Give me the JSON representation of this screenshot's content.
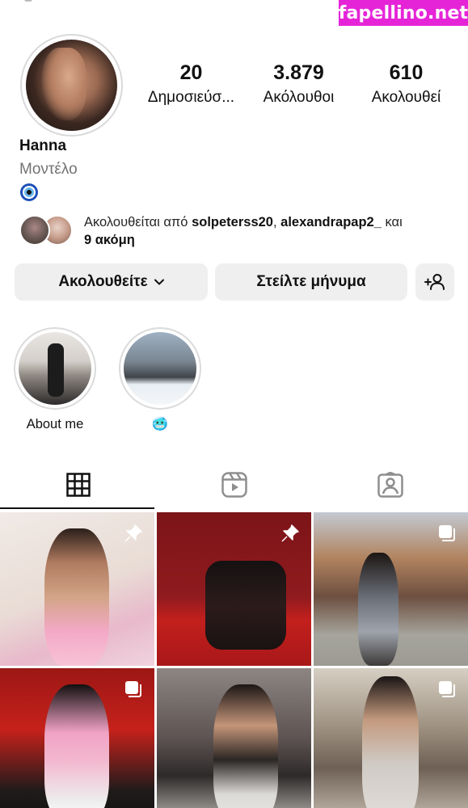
{
  "watermark": "fapellino.net",
  "profile": {
    "name": "Hanna",
    "category": "Μοντέλο",
    "bio_emoji": "evil-eye-emoji",
    "stats": [
      {
        "value": "20",
        "label": "Δημοσιεύσ..."
      },
      {
        "value": "3.879",
        "label": "Ακόλουθοι"
      },
      {
        "value": "610",
        "label": "Ακολουθεί"
      }
    ],
    "followed_by": {
      "prefix": "Ακολουθείται από ",
      "user1": "solpeterss20",
      "separator": ", ",
      "user2": "alexandrapap2_",
      "conjunction": " και",
      "more": "9 ακόμη"
    }
  },
  "actions": {
    "following_label": "Ακολουθείτε",
    "message_label": "Στείλτε μήνυμα",
    "add_user_icon": "add-person-icon"
  },
  "highlights": [
    {
      "label": "About me"
    },
    {
      "label": "🥶"
    }
  ],
  "tabs": [
    {
      "icon": "grid-icon",
      "active": true
    },
    {
      "icon": "reels-icon",
      "active": false
    },
    {
      "icon": "tagged-icon",
      "active": false
    }
  ],
  "posts": [
    {
      "badge": "pin-icon"
    },
    {
      "badge": "pin-icon"
    },
    {
      "badge": "carousel-icon"
    },
    {
      "badge": "carousel-icon"
    },
    {
      "badge": ""
    },
    {
      "badge": "carousel-icon"
    }
  ],
  "colors": {
    "button_bg": "#efefef",
    "secondary_text": "#737373",
    "watermark_bg": "#e524d8"
  }
}
